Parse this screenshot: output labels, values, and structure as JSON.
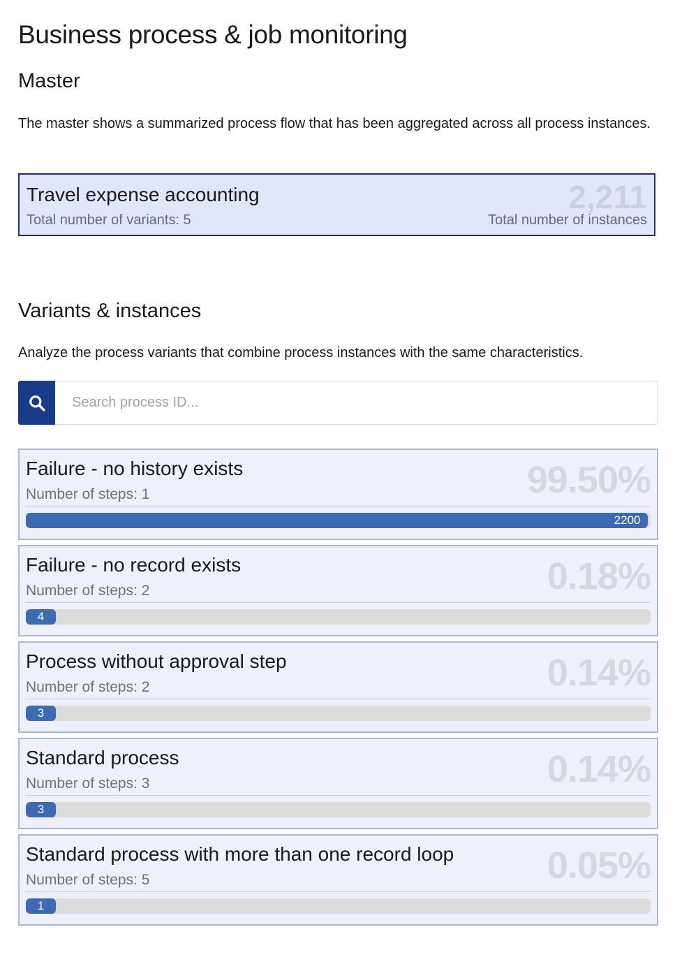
{
  "page": {
    "title": "Business process & job monitoring"
  },
  "master": {
    "heading": "Master",
    "description": "The master shows a summarized process flow that has been aggregated across all process instances.",
    "card": {
      "title": "Travel expense accounting",
      "variants_label": "Total number of variants: 5",
      "instances_value": "2,211",
      "instances_label": "Total number of instances"
    }
  },
  "variants": {
    "heading": "Variants & instances",
    "description": "Analyze the process variants that combine process instances with the same characteristics.",
    "search": {
      "placeholder": "Search process ID...",
      "value": "",
      "icon": "search-icon"
    },
    "items": [
      {
        "title": "Failure - no history exists",
        "steps": "Number of steps: 1",
        "percent": "99.50%",
        "count": "2200",
        "share": 0.995
      },
      {
        "title": "Failure - no record exists",
        "steps": "Number of steps: 2",
        "percent": "0.18%",
        "count": "4",
        "share": 0.0018
      },
      {
        "title": "Process without approval step",
        "steps": "Number of steps: 2",
        "percent": "0.14%",
        "count": "3",
        "share": 0.0014
      },
      {
        "title": "Standard process",
        "steps": "Number of steps: 3",
        "percent": "0.14%",
        "count": "3",
        "share": 0.0014
      },
      {
        "title": "Standard process with more than one record loop",
        "steps": "Number of steps: 5",
        "percent": "0.05%",
        "count": "1",
        "share": 0.0005
      }
    ]
  },
  "colors": {
    "accent": "#1a3a8a",
    "bar_fill": "#3d6bb3",
    "card_border": "#a9b8de",
    "master_border": "#1f2f6e"
  }
}
